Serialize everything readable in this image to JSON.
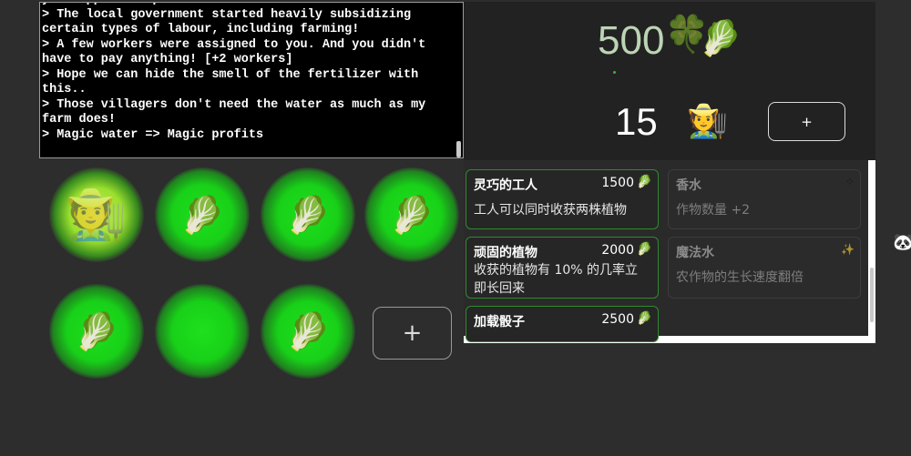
{
  "log": {
    "text": "your opponents policies.\n> The local government started heavily subsidizing certain types of labour, including farming!\n> A few workers were assigned to you. And you didn't have to pay anything! [+2 workers]\n> Hope we can hide the smell of the fertilizer with this..\n> Those villagers don't need the water as much as my farm does!\n> Magic water => Magic profits"
  },
  "stats": {
    "money": "500",
    "money_icon": "🥬",
    "clover_icon": "🍀",
    "workers": "15",
    "workers_icon": "🧑‍🌾",
    "add_worker_label": "+"
  },
  "upgrades": [
    {
      "name": "灵巧的工人",
      "price": "1500",
      "price_icon": "🥬",
      "desc": "工人可以同时收获两株植物",
      "state": "active"
    },
    {
      "name": "香水",
      "icon": "locked-dots-icon",
      "desc": "作物数量 +2",
      "state": "locked"
    },
    {
      "name": "顽固的植物",
      "price": "2000",
      "price_icon": "🥬",
      "desc": "收获的植物有 10% 的几率立即长回来",
      "state": "active"
    },
    {
      "name": "魔法水",
      "icon": "sparkle-icon",
      "desc": "农作物的生长速度翻倍",
      "state": "locked"
    },
    {
      "name": "加载骰子",
      "price": "2500",
      "price_icon": "🥬",
      "desc": "",
      "state": "active"
    }
  ],
  "field": {
    "plots": [
      {
        "content": "🧑‍🌾",
        "kind": "farmer"
      },
      {
        "content": "🥬",
        "kind": "crop"
      },
      {
        "content": "🥬",
        "kind": "crop"
      },
      {
        "content": "🥬",
        "kind": "crop"
      },
      {
        "content": "🥬",
        "kind": "crop"
      },
      {
        "content": "",
        "kind": "empty"
      },
      {
        "content": "🥬",
        "kind": "crop"
      }
    ],
    "add_plot_label": "+"
  },
  "side_icon": "🐼"
}
